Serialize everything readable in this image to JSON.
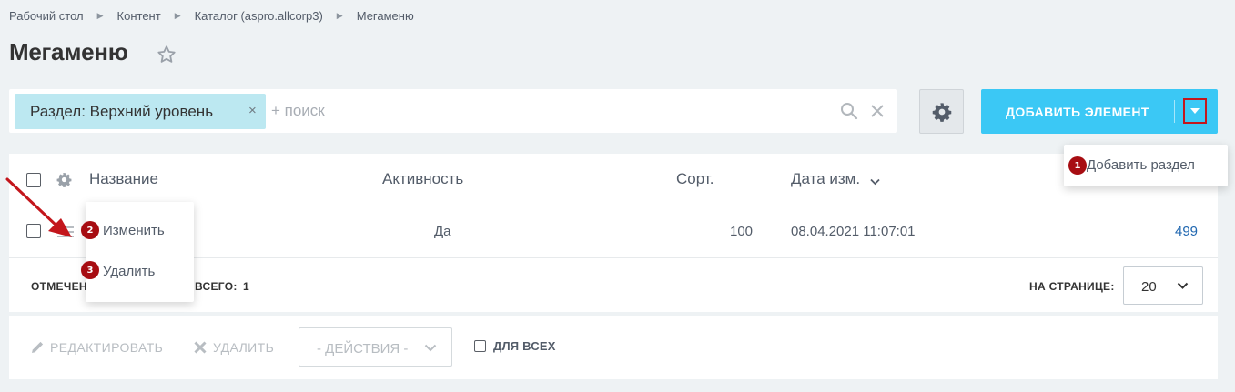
{
  "breadcrumb": [
    {
      "label": "Рабочий стол"
    },
    {
      "label": "Контент"
    },
    {
      "label": "Каталог (aspro.allcorp3)"
    },
    {
      "label": "Мегаменю"
    }
  ],
  "page": {
    "title": "Мегаменю"
  },
  "filter": {
    "chip_label": "Раздел: Верхний уровень",
    "chip_close": "×",
    "search_placeholder": "+ поиск"
  },
  "toolbar": {
    "add_label": "ДОБАВИТЬ ЭЛЕМЕНТ"
  },
  "add_menu": {
    "items": [
      {
        "badge": "1",
        "label": "Добавить раздел"
      }
    ]
  },
  "grid": {
    "columns": {
      "name": "Название",
      "active": "Активность",
      "sort": "Сорт.",
      "date": "Дата изм."
    },
    "rows": [
      {
        "active": "Да",
        "sort": "100",
        "date": "08.04.2021 11:07:01",
        "id": "499"
      }
    ],
    "footer": {
      "marked_prefix": "ОТМЕЧЕН",
      "total_label": "ВСЕГО:",
      "total_value": "1",
      "per_page_label": "НА СТРАНИЦЕ:",
      "per_page_value": "20"
    }
  },
  "row_menu": {
    "items": [
      {
        "badge": "2",
        "label": "Изменить"
      },
      {
        "badge": "3",
        "label": "Удалить"
      }
    ]
  },
  "action_panel": {
    "edit_label": "РЕДАКТИРОВАТЬ",
    "delete_label": "УДАЛИТЬ",
    "actions_placeholder": "- ДЕЙСТВИЯ -",
    "for_all_label": "ДЛЯ ВСЕХ"
  },
  "colors": {
    "accent": "#3bc8f5",
    "chip": "#bce8f1",
    "badge": "#a70d12",
    "arrow": "#c3161c",
    "link": "#2067b0"
  }
}
